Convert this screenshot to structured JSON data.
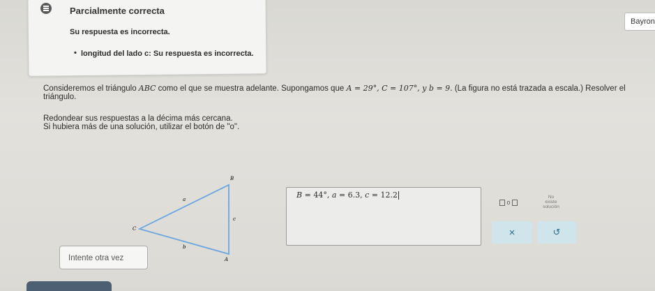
{
  "feedback": {
    "title": "Parcialmente correcta",
    "subtitle": "Su respuesta es incorrecta.",
    "bullet": "longitud del lado c: Su respuesta es incorrecta."
  },
  "user": {
    "name": "Bayron"
  },
  "problem": {
    "line1_prefix": "Consideremos el triángulo ",
    "triangle_name": "ABC",
    "line1_mid": " como el que se muestra adelante. Supongamos que ",
    "given_A": "A = 29°, C = 107°, y b = 9.",
    "line1_suffix": " (La figura no está trazada a escala.) Resolver el",
    "line2": "triángulo.",
    "round_note": "Redondear sus respuestas a la décima más cercana.",
    "multi_note": "Si hubiera más de una solución, utilizar el botón de \"o\"."
  },
  "figure": {
    "labels": {
      "B": "B",
      "a": "a",
      "c": "c",
      "C": "C",
      "b": "b",
      "A": "A"
    }
  },
  "answer": {
    "B_label": "B",
    "B_value": "44",
    "a_label": "a",
    "a_value": "6.3",
    "c_label": "c",
    "c_value": "12.2",
    "equals": "=",
    "degree": "°",
    "sep": ","
  },
  "tools": {
    "or_label": "o",
    "no_solution_lines": [
      "No",
      "existe",
      "solución"
    ],
    "clear_symbol": "×",
    "undo_symbol": "↺"
  },
  "retry_label": "Intente otra vez",
  "colors": {
    "triangle": "#6aa6e0",
    "button_bg": "#d0e4ec",
    "button_fg": "#2a6d8a"
  }
}
